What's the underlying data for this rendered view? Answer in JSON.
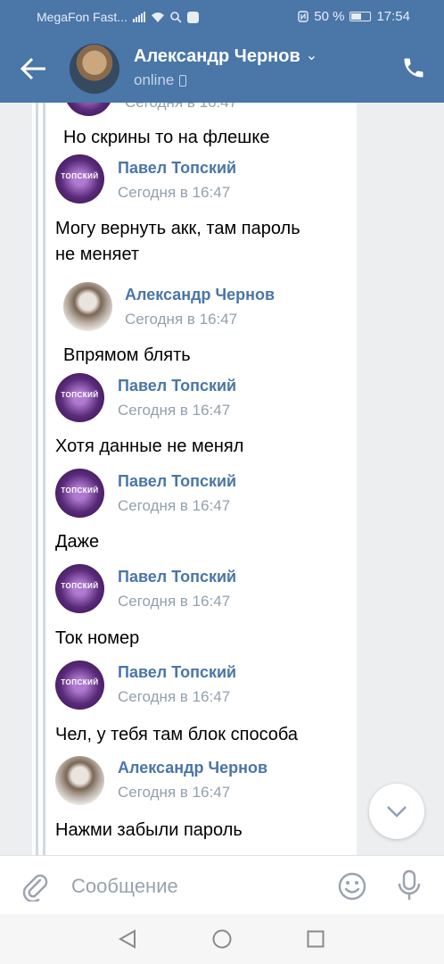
{
  "status_bar": {
    "carrier": "MegaFon Fast...",
    "battery": "50 %",
    "time": "17:54",
    "icons": [
      "signal-icon",
      "wifi-icon",
      "search-icon",
      "shield-icon",
      "nfc-icon",
      "battery-icon"
    ]
  },
  "header": {
    "title": "Александр Чернов",
    "status": "online",
    "icons": [
      "back-arrow-icon",
      "chevron-down-icon",
      "mobile-icon",
      "phone-icon"
    ]
  },
  "messages": {
    "top_time": "Сегодня в 16:47",
    "m0_text": "Но скрины то на флешке",
    "m1_name": "Павел Топский",
    "m1_time": "Сегодня в 16:47",
    "m1_text1": "Могу вернуть акк, там пароль",
    "m1_text2": "не меняет",
    "m2_name": "Александр Чернов",
    "m2_time": "Сегодня в 16:47",
    "m2_text": "Впрямом блять",
    "m3_name": "Павел Топский",
    "m3_time": "Сегодня в 16:47",
    "m3_text": "Хотя данные не менял",
    "m4_name": "Павел Топский",
    "m4_time": "Сегодня в 16:47",
    "m4_text": "Даже",
    "m5_name": "Павел Топский",
    "m5_time": "Сегодня в 16:47",
    "m5_text": "Ток номер",
    "m6_name": "Павел Топский",
    "m6_time": "Сегодня в 16:47",
    "m6_text": "Чел, у тебя там блок способа",
    "m7_name": "Александр Чернов",
    "m7_time": "Сегодня в 16:47",
    "m7_text": "Нажми забыли пароль",
    "avatar_text": "ТОПСКИЙ"
  },
  "composer": {
    "placeholder": "Сообщение",
    "icons": [
      "paperclip-icon",
      "emoji-icon",
      "microphone-icon"
    ]
  },
  "navbar": {
    "icons": [
      "nav-back-icon",
      "nav-home-icon",
      "nav-recent-icon"
    ]
  },
  "colors": {
    "header_bg": "#4a76a8",
    "name_color": "#4a76a8",
    "time_color": "#93a0ad",
    "chat_bg": "#edeef0"
  }
}
